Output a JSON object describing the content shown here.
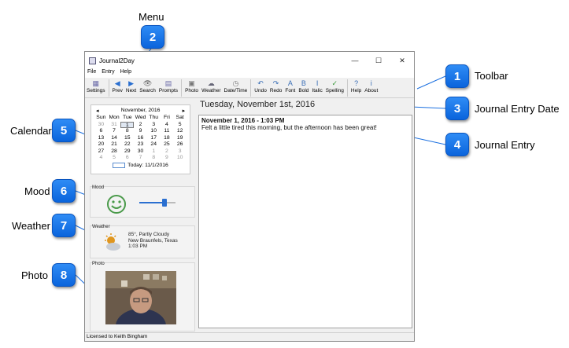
{
  "callouts": {
    "menu": {
      "num": "2",
      "label": "Menu"
    },
    "toolbar": {
      "num": "1",
      "label": "Toolbar"
    },
    "date": {
      "num": "3",
      "label": "Journal Entry Date"
    },
    "entry": {
      "num": "4",
      "label": "Journal Entry"
    },
    "calendar": {
      "num": "5",
      "label": "Calendar"
    },
    "mood": {
      "num": "6",
      "label": "Mood"
    },
    "weather": {
      "num": "7",
      "label": "Weather"
    },
    "photo": {
      "num": "8",
      "label": "Photo"
    }
  },
  "window": {
    "title": "Journal2Day",
    "controls": {
      "minimize": "—",
      "maximize": "☐",
      "close": "✕"
    }
  },
  "menu": [
    "File",
    "Entry",
    "Help"
  ],
  "toolbar": [
    {
      "label": "Settings",
      "icon": "▦",
      "color": "#6a6aa8"
    },
    {
      "sep": true
    },
    {
      "label": "Prev",
      "icon": "◀",
      "color": "#2a6fd0"
    },
    {
      "label": "Next",
      "icon": "▶",
      "color": "#2a6fd0"
    },
    {
      "label": "Search",
      "icon": "👁",
      "color": "#666"
    },
    {
      "label": "Prompts",
      "icon": "▤",
      "color": "#6a6aa8"
    },
    {
      "sep": true
    },
    {
      "label": "Photo",
      "icon": "▣",
      "color": "#777"
    },
    {
      "label": "Weather",
      "icon": "☁",
      "color": "#667"
    },
    {
      "label": "Date/Time",
      "icon": "◷",
      "color": "#777"
    },
    {
      "sep": true
    },
    {
      "label": "Undo",
      "icon": "↶",
      "color": "#3b6fb6"
    },
    {
      "label": "Redo",
      "icon": "↷",
      "color": "#3b6fb6"
    },
    {
      "label": "Font",
      "icon": "A",
      "color": "#3b6fb6"
    },
    {
      "label": "Bold",
      "icon": "B",
      "color": "#3b6fb6"
    },
    {
      "label": "Italic",
      "icon": "I",
      "color": "#3b6fb6"
    },
    {
      "label": "Spelling",
      "icon": "✓",
      "color": "#3a9a3a"
    },
    {
      "sep": true
    },
    {
      "label": "Help",
      "icon": "?",
      "color": "#3b6fb6"
    },
    {
      "label": "About",
      "icon": "i",
      "color": "#3b6fb6"
    }
  ],
  "calendar": {
    "month": "November, 2016",
    "prev": "◂",
    "next": "▸",
    "days": [
      "Sun",
      "Mon",
      "Tue",
      "Wed",
      "Thu",
      "Fri",
      "Sat"
    ],
    "cells": [
      [
        "30",
        "g"
      ],
      [
        "31",
        "g"
      ],
      [
        "1",
        "s"
      ],
      [
        "2",
        ""
      ],
      [
        "3",
        ""
      ],
      [
        "4",
        ""
      ],
      [
        "5",
        ""
      ],
      [
        "6",
        ""
      ],
      [
        "7",
        ""
      ],
      [
        "8",
        ""
      ],
      [
        "9",
        ""
      ],
      [
        "10",
        ""
      ],
      [
        "11",
        ""
      ],
      [
        "12",
        ""
      ],
      [
        "13",
        ""
      ],
      [
        "14",
        ""
      ],
      [
        "15",
        ""
      ],
      [
        "16",
        ""
      ],
      [
        "17",
        ""
      ],
      [
        "18",
        ""
      ],
      [
        "19",
        ""
      ],
      [
        "20",
        ""
      ],
      [
        "21",
        ""
      ],
      [
        "22",
        ""
      ],
      [
        "23",
        ""
      ],
      [
        "24",
        ""
      ],
      [
        "25",
        ""
      ],
      [
        "26",
        ""
      ],
      [
        "27",
        ""
      ],
      [
        "28",
        ""
      ],
      [
        "29",
        ""
      ],
      [
        "30",
        ""
      ],
      [
        "1",
        "g"
      ],
      [
        "2",
        "g"
      ],
      [
        "3",
        "g"
      ],
      [
        "4",
        "g"
      ],
      [
        "5",
        "g"
      ],
      [
        "6",
        "g"
      ],
      [
        "7",
        "g"
      ],
      [
        "8",
        "g"
      ],
      [
        "9",
        "g"
      ],
      [
        "10",
        "g"
      ]
    ],
    "today": "Today: 11/1/2016"
  },
  "mood": {
    "title": "Mood",
    "level": 0.7
  },
  "weather": {
    "title": "Weather",
    "line1": "85°, Partly Cloudy",
    "line2": "New Braunfels, Texas",
    "line3": "1:03 PM",
    "icon": "partly-cloudy-icon"
  },
  "photo": {
    "title": "Photo"
  },
  "entry": {
    "date_heading": "Tuesday, November 1st, 2016",
    "title": "November 1, 2016 - 1:03 PM",
    "body": "Felt a little tired this morning, but the afternoon has been great!"
  },
  "status": {
    "text": "Licensed to Keith Bingham"
  }
}
